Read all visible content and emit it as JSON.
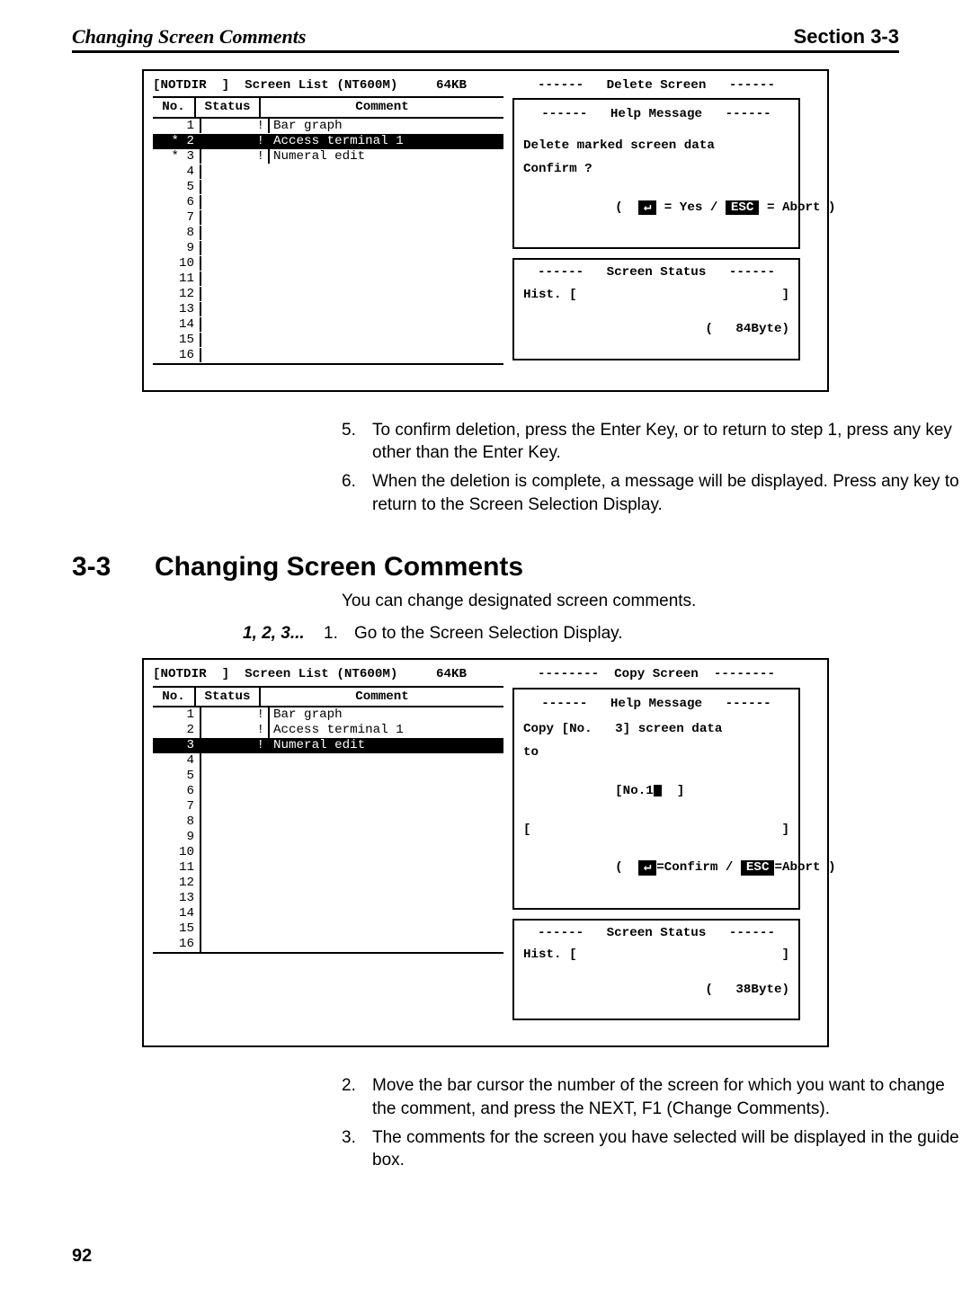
{
  "header": {
    "left": "Changing Screen Comments",
    "right": "Section 3-3"
  },
  "screenshot1": {
    "title": "[NOTDIR  ]  Screen List (NT600M)     64KB",
    "columns": {
      "no": "No.",
      "status": "Status",
      "comment": "Comment"
    },
    "rows": [
      {
        "no": "1",
        "status": "!",
        "comment": "Bar graph",
        "selected": false,
        "mark": ""
      },
      {
        "no": "2",
        "status": "!",
        "comment": "Access terminal 1",
        "selected": true,
        "mark": "*"
      },
      {
        "no": "3",
        "status": "!",
        "comment": "Numeral edit",
        "selected": false,
        "mark": "*"
      },
      {
        "no": "4"
      },
      {
        "no": "5"
      },
      {
        "no": "6"
      },
      {
        "no": "7"
      },
      {
        "no": "8"
      },
      {
        "no": "9"
      },
      {
        "no": "10"
      },
      {
        "no": "11"
      },
      {
        "no": "12"
      },
      {
        "no": "13"
      },
      {
        "no": "14"
      },
      {
        "no": "15"
      },
      {
        "no": "16"
      }
    ],
    "right_title": "------   Delete Screen   ------",
    "help_title": "------   Help Message   ------",
    "help_lines": [
      "Delete marked screen data",
      "Confirm ?"
    ],
    "help_keys_pre": "(  ",
    "help_keys_yes": " = Yes / ",
    "help_keys_abort": " = Abort )",
    "status_title": "------   Screen Status   ------",
    "hist_label": "Hist. [",
    "hist_close": "]",
    "byte_open": "(",
    "byte_value": "   84Byte)"
  },
  "after1": {
    "item5": "To confirm deletion, press the Enter Key, or to return to step 1, press any key other than the Enter Key.",
    "item6": "When the deletion is complete, a message will be displayed. Press any key to return to the Screen Selection Display."
  },
  "section": {
    "num": "3-3",
    "title": "Changing Screen Comments"
  },
  "intro": "You can change designated screen comments.",
  "steps_lead": "1, 2, 3...",
  "step1": "Go to the Screen Selection Display.",
  "screenshot2": {
    "title": "[NOTDIR  ]  Screen List (NT600M)     64KB",
    "columns": {
      "no": "No.",
      "status": "Status",
      "comment": "Comment"
    },
    "rows": [
      {
        "no": "1",
        "status": "!",
        "comment": "Bar graph",
        "selected": false
      },
      {
        "no": "2",
        "status": "!",
        "comment": "Access terminal 1",
        "selected": false
      },
      {
        "no": "3",
        "status": "!",
        "comment": "Numeral edit",
        "selected": true
      },
      {
        "no": "4"
      },
      {
        "no": "5"
      },
      {
        "no": "6"
      },
      {
        "no": "7"
      },
      {
        "no": "8"
      },
      {
        "no": "9"
      },
      {
        "no": "10"
      },
      {
        "no": "11"
      },
      {
        "no": "12"
      },
      {
        "no": "13"
      },
      {
        "no": "14"
      },
      {
        "no": "15"
      },
      {
        "no": "16"
      }
    ],
    "right_title": "--------  Copy Screen  --------",
    "help_title": "------   Help Message   ------",
    "help_line1": "Copy [No.   3] screen data",
    "help_line2": "to",
    "help_line3_pre": "[No.1",
    "help_line3_post": "  ]",
    "help_line4_open": "[",
    "help_line4_close": "]",
    "help_keys_pre": "(  ",
    "help_keys_confirm": "=Confirm / ",
    "help_keys_abort": "=Abort )",
    "status_title": "------   Screen Status   ------",
    "hist_label": "Hist. [",
    "hist_close": "]",
    "byte_open": "(",
    "byte_value": "   38Byte)"
  },
  "after2": {
    "item2": "Move the bar cursor the number of the screen for which you want to change the comment, and press the NEXT, F1 (Change Comments).",
    "item3": "The comments for the screen you have selected will be displayed in the guide box."
  },
  "pagenum": "92"
}
